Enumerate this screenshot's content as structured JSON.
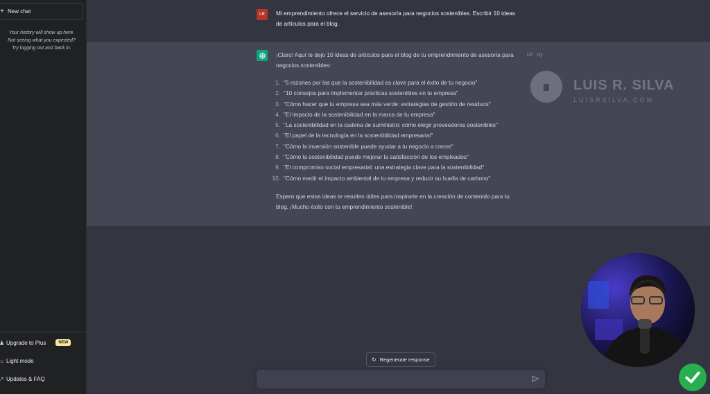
{
  "sidebar": {
    "new_chat": "New chat",
    "history_note": [
      "Your history will show up here.",
      "Not seeing what you expected?",
      "Try logging out and back in."
    ],
    "bottom": {
      "upgrade": "Upgrade to Plus",
      "upgrade_badge": "NEW",
      "light_mode": "Light mode",
      "updates": "Updates & FAQ"
    }
  },
  "conversation": {
    "user_avatar": "LR",
    "user_message": "Mi emprendimiento ofrece el servicio de asesoría para negocios sostenibles. Escribir 10 ideas de artículos para el blog.",
    "assistant_intro": "¡Claro! Aquí te dejo 10 ideas de artículos para el blog de tu emprendimiento de asesoría para negocios sostenibles:",
    "ideas": [
      {
        "num": "1.",
        "text": "\"5 razones por las que la sostenibilidad es clave para el éxito de tu negocio\""
      },
      {
        "num": "2.",
        "text": "\"10 consejos para implementar prácticas sostenibles en tu empresa\""
      },
      {
        "num": "3.",
        "text": "\"Cómo hacer que tu empresa sea más verde: estrategias de gestión de residuos\""
      },
      {
        "num": "4.",
        "text": "\"El impacto de la sostenibilidad en la marca de tu empresa\""
      },
      {
        "num": "5.",
        "text": "\"La sostenibilidad en la cadena de suministro: cómo elegir proveedores sostenibles\""
      },
      {
        "num": "6.",
        "text": "\"El papel de la tecnología en la sostenibilidad empresarial\""
      },
      {
        "num": "7.",
        "text": "\"Cómo la inversión sostenible puede ayudar a tu negocio a crecer\""
      },
      {
        "num": "8.",
        "text": "\"Cómo la sostenibilidad puede mejorar la satisfacción de los empleados\""
      },
      {
        "num": "9.",
        "text": "\"El compromiso social empresarial: una estrategia clave para la sostenibilidad\""
      },
      {
        "num": "10.",
        "text": "\"Cómo medir el impacto ambiental de tu empresa y reducir su huella de carbono\""
      }
    ],
    "assistant_outro": "Espero que estas ideas te resulten útiles para inspirarte en la creación de contenido para tu blog. ¡Mucho éxito con tu emprendimiento sostenible!"
  },
  "regenerate_label": "Regenerate response",
  "composer": {
    "value": "",
    "placeholder": ""
  },
  "watermark": {
    "title": "LUIS R. SILVA",
    "subtitle": "LUISRSILVA.COM"
  },
  "colors": {
    "sidebar": "#202123",
    "main": "#343541",
    "assistant_bg": "#444654",
    "bot_avatar": "#10a37f",
    "user_avatar": "#b5362d",
    "check": "#27ae4f"
  }
}
